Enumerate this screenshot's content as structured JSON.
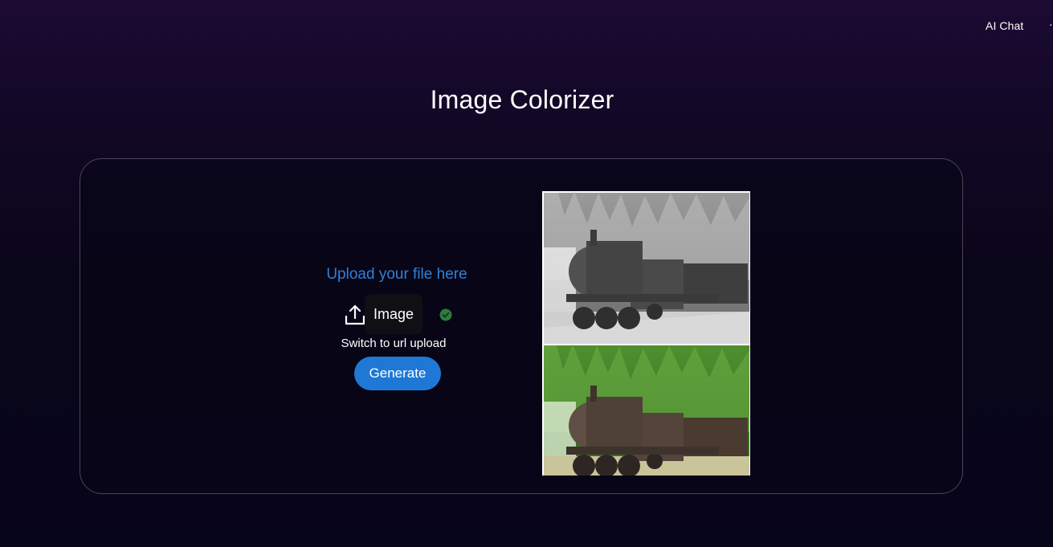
{
  "nav": {
    "ai_chat_label": "AI Chat",
    "cut_label": "·"
  },
  "page": {
    "title": "Image Colorizer"
  },
  "upload": {
    "title": "Upload your file here",
    "type_label": "Image",
    "switch_label": "Switch to url upload",
    "generate_label": "Generate",
    "icon": "upload-icon",
    "status_icon": "check-circle-icon",
    "status": "selected"
  },
  "preview": {
    "top_image": "grayscale train photo",
    "bottom_image": "colorized train photo"
  },
  "colors": {
    "accent": "#1f78d6",
    "upload_title": "#2f80d8",
    "panel_border": "#4a4458",
    "check_green": "#2f7a3c"
  }
}
